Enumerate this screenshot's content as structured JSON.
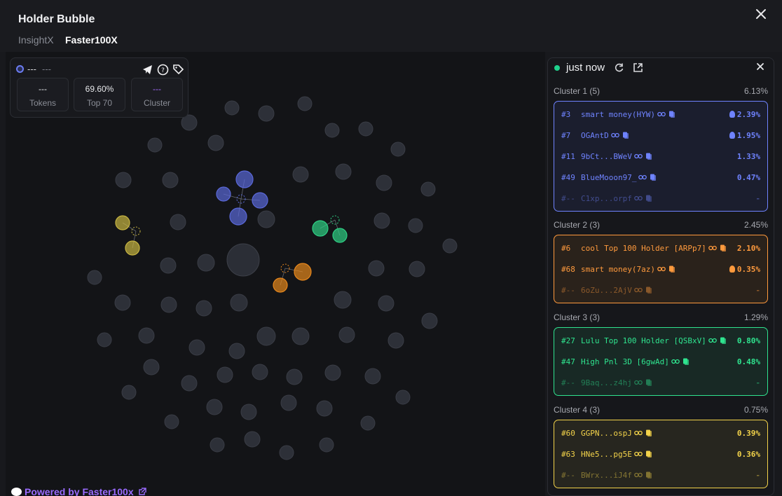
{
  "header": {
    "title": "Holder Bubble",
    "tabs": [
      {
        "label": "InsightX"
      },
      {
        "label": "Faster100X"
      }
    ]
  },
  "stats": {
    "address": "---",
    "address_sub": "---",
    "boxes": [
      {
        "value": "---",
        "label": "Tokens"
      },
      {
        "value": "69.60%",
        "label": "Top 70"
      },
      {
        "value": "---",
        "label": "Cluster"
      }
    ]
  },
  "footer": {
    "text": "Powered by Faster100x"
  },
  "panel": {
    "status": "just now",
    "clusters": [
      {
        "title": "Cluster 1 (5)",
        "pct": "6.13%",
        "color": "#6f83ff",
        "rows": [
          {
            "rank": "#3",
            "name": "smart money(HYW)",
            "value": "2.39%",
            "bulb": true
          },
          {
            "rank": "#7",
            "name": "OGAntD",
            "value": "1.95%",
            "bulb": true
          },
          {
            "rank": "#11",
            "name": "9bCt...BWeV",
            "value": "1.33%"
          },
          {
            "rank": "#49",
            "name": "BlueMooon97_",
            "value": "0.47%"
          },
          {
            "rank": "#--",
            "name": "C1xp...orpf",
            "value": "-",
            "dim": true
          }
        ]
      },
      {
        "title": "Cluster 2 (3)",
        "pct": "2.45%",
        "color": "#ff9a3d",
        "rows": [
          {
            "rank": "#6",
            "name": "cool Top 100 Holder [ARPp7]",
            "value": "2.10%"
          },
          {
            "rank": "#68",
            "name": "smart money(7az)",
            "value": "0.35%",
            "bulb": true
          },
          {
            "rank": "#--",
            "name": "6oZu...2AjV",
            "value": "-",
            "dim": true
          }
        ]
      },
      {
        "title": "Cluster 3 (3)",
        "pct": "1.29%",
        "color": "#2fe48f",
        "rows": [
          {
            "rank": "#27",
            "name": "Lulu Top 100 Holder [QSBxV]",
            "value": "0.80%"
          },
          {
            "rank": "#47",
            "name": "High Pnl 3D [6gwAd]",
            "value": "0.48%"
          },
          {
            "rank": "#--",
            "name": "9Baq...z4hj",
            "value": "-",
            "dim": true
          }
        ]
      },
      {
        "title": "Cluster 4 (3)",
        "pct": "0.75%",
        "color": "#f3d34a",
        "rows": [
          {
            "rank": "#60",
            "name": "GGPN...ospJ",
            "value": "0.39%"
          },
          {
            "rank": "#63",
            "name": "HNe5...pg5E",
            "value": "0.36%"
          },
          {
            "rank": "#--",
            "name": "BWrx...iJ4f",
            "value": "-",
            "dim": true
          }
        ]
      }
    ]
  },
  "colors": {
    "cluster1": "#5a68d8",
    "cluster2": "#e6871d",
    "cluster3": "#2fcf84",
    "cluster4": "#c7b542",
    "neutral": "#2d3038"
  }
}
